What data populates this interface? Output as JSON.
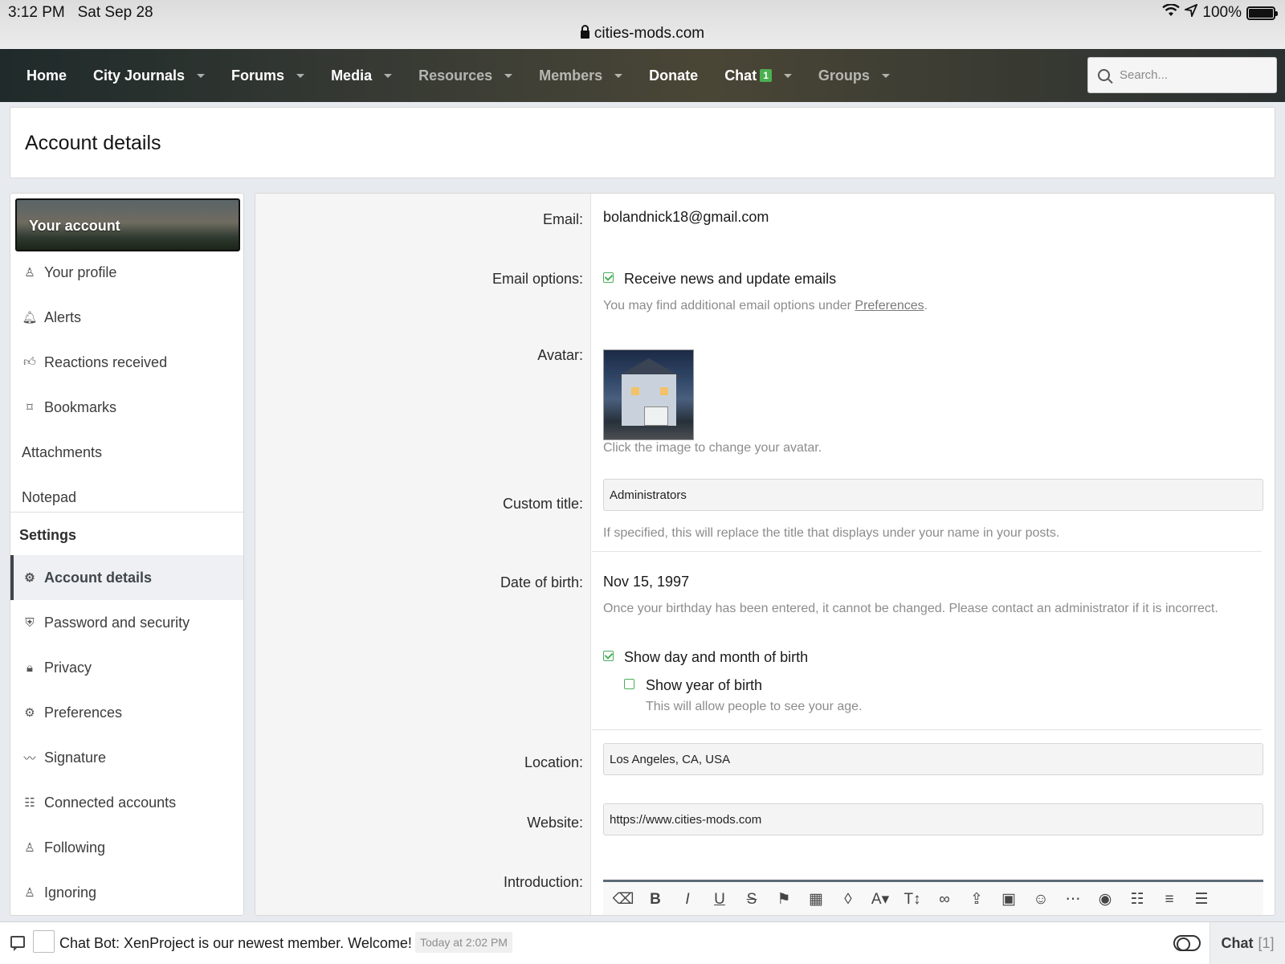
{
  "status": {
    "time": "3:12 PM",
    "date": "Sat Sep 28",
    "battery": "100%"
  },
  "browser": {
    "url": "cities-mods.com"
  },
  "nav": {
    "items": [
      {
        "label": "Home",
        "caret": false
      },
      {
        "label": "City Journals",
        "caret": true
      },
      {
        "label": "Forums",
        "caret": true
      },
      {
        "label": "Media",
        "caret": true
      },
      {
        "label": "Resources",
        "caret": true
      },
      {
        "label": "Members",
        "caret": true
      },
      {
        "label": "Donate",
        "caret": false
      },
      {
        "label": "Chat",
        "badge": "1",
        "caret": true
      },
      {
        "label": "Groups",
        "caret": true
      }
    ],
    "search_placeholder": "Search..."
  },
  "page": {
    "title": "Account details"
  },
  "sidebar": {
    "header": "Your account",
    "items": [
      {
        "label": "Your profile",
        "icon": "user-icon"
      },
      {
        "label": "Alerts",
        "icon": "bell-icon"
      },
      {
        "label": "Reactions received",
        "icon": "thumbs-up-icon"
      },
      {
        "label": "Bookmarks",
        "icon": "bookmark-icon"
      },
      {
        "label": "Attachments",
        "icon": ""
      },
      {
        "label": "Notepad",
        "icon": ""
      }
    ],
    "settings_heading": "Settings",
    "settings_items": [
      {
        "label": "Account details",
        "icon": "user-cog-icon",
        "active": true
      },
      {
        "label": "Password and security",
        "icon": "shield-icon"
      },
      {
        "label": "Privacy",
        "icon": "lock-icon"
      },
      {
        "label": "Preferences",
        "icon": "cogs-icon"
      },
      {
        "label": "Signature",
        "icon": "signature-icon"
      },
      {
        "label": "Connected accounts",
        "icon": "users-icon"
      },
      {
        "label": "Following",
        "icon": "user-plus-icon"
      },
      {
        "label": "Ignoring",
        "icon": "user-minus-icon"
      }
    ]
  },
  "form": {
    "email_label": "Email:",
    "email_value": "bolandnick18@gmail.com",
    "email_options_label": "Email options:",
    "email_news_checkbox": "Receive news and update emails",
    "email_news_checked": true,
    "email_options_hint": "You may find additional email options under ",
    "email_options_link": "Preferences",
    "email_options_hint_end": ".",
    "avatar_label": "Avatar:",
    "avatar_hint": "Click the image to change your avatar.",
    "custom_title_label": "Custom title:",
    "custom_title_value": "Administrators",
    "custom_title_hint": "If specified, this will replace the title that displays under your name in your posts.",
    "dob_label": "Date of birth:",
    "dob_value": "Nov 15, 1997",
    "dob_hint": "Once your birthday has been entered, it cannot be changed. Please contact an administrator if it is incorrect.",
    "show_day_month": "Show day and month of birth",
    "show_day_month_checked": true,
    "show_year": "Show year of birth",
    "show_year_checked": false,
    "show_year_hint": "This will allow people to see your age.",
    "location_label": "Location:",
    "location_value": "Los Angeles, CA, USA",
    "website_label": "Website:",
    "website_value": "https://www.cities-mods.com",
    "intro_label": "Introduction:"
  },
  "editor_tools": [
    "eraser-icon",
    "bold-icon",
    "italic-icon",
    "underline-icon",
    "strikethrough-icon",
    "flag-icon",
    "checkered-flag-icon",
    "droplet-icon",
    "font-color-icon",
    "text-size-icon",
    "link-icon",
    "upload-icon",
    "image-icon",
    "smiley-icon",
    "more-icon",
    "camera-icon",
    "users-icon",
    "align-icon",
    "list-icon"
  ],
  "chat": {
    "message": "Chat Bot: XenProject is our newest member. Welcome!",
    "time": "Today at 2:02 PM",
    "button": "Chat",
    "count": "[1]"
  },
  "colors": {
    "check_green": "#4cae5a",
    "badge_green": "#4cb050",
    "nav_dark": "#2f3530"
  }
}
